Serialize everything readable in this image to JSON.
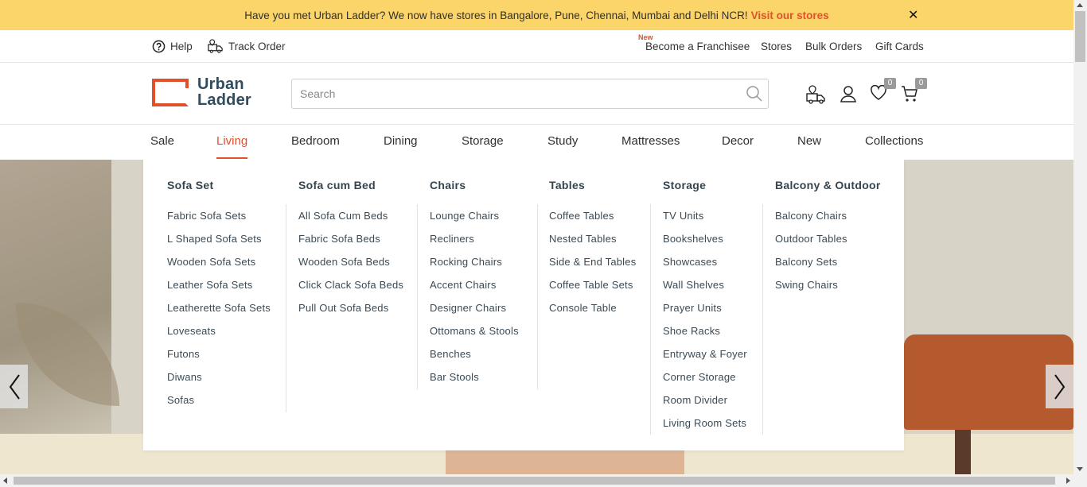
{
  "announcement": {
    "text": "Have you met Urban Ladder? We now have stores in Bangalore, Pune, Chennai, Mumbai and Delhi NCR!",
    "link": "Visit our stores",
    "close": "✕"
  },
  "utility": {
    "help": "Help",
    "track_order": "Track Order",
    "new_tag": "New",
    "franchisee": "Become a Franchisee",
    "stores": "Stores",
    "bulk_orders": "Bulk Orders",
    "gift_cards": "Gift Cards"
  },
  "header": {
    "logo_line1": "Urban",
    "logo_line2": "Ladder",
    "search_placeholder": "Search",
    "wishlist_count": "0",
    "cart_count": "0"
  },
  "nav": [
    "Sale",
    "Living",
    "Bedroom",
    "Dining",
    "Storage",
    "Study",
    "Mattresses",
    "Decor",
    "New",
    "Collections"
  ],
  "mega_menu": [
    {
      "heading": "Sofa Set",
      "items": [
        "Fabric Sofa Sets",
        "L Shaped Sofa Sets",
        "Wooden Sofa Sets",
        "Leather Sofa Sets",
        "Leatherette Sofa Sets",
        "Loveseats",
        "Futons",
        "Diwans",
        "Sofas"
      ]
    },
    {
      "heading": "Sofa cum Bed",
      "items": [
        "All Sofa Cum Beds",
        "Fabric Sofa Beds",
        "Wooden Sofa Beds",
        "Click Clack Sofa Beds",
        "Pull Out Sofa Beds"
      ]
    },
    {
      "heading": "Chairs",
      "items": [
        "Lounge Chairs",
        "Recliners",
        "Rocking Chairs",
        "Accent Chairs",
        "Designer Chairs",
        "Ottomans & Stools",
        "Benches",
        "Bar Stools"
      ]
    },
    {
      "heading": "Tables",
      "items": [
        "Coffee Tables",
        "Nested Tables",
        "Side & End Tables",
        "Coffee Table Sets",
        "Console Table"
      ]
    },
    {
      "heading": "Storage",
      "items": [
        "TV Units",
        "Bookshelves",
        "Showcases",
        "Wall Shelves",
        "Prayer Units",
        "Shoe Racks",
        "Entryway & Foyer",
        "Corner Storage",
        "Room Divider",
        "Living Room Sets"
      ]
    },
    {
      "heading": "Balcony & Outdoor",
      "items": [
        "Balcony Chairs",
        "Outdoor Tables",
        "Balcony Sets",
        "Swing Chairs"
      ]
    }
  ],
  "colors": {
    "accent": "#e0512b",
    "banner": "#fbd56a",
    "text": "#2f2f2f"
  }
}
